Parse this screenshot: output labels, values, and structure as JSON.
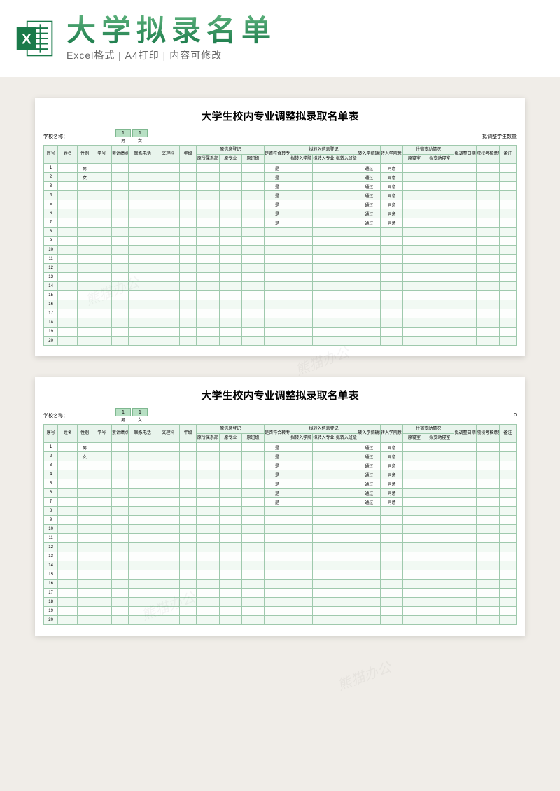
{
  "header": {
    "title": "大学拟录名单",
    "subtitle": "Excel格式 | A4打印 | 内容可修改"
  },
  "sheet": {
    "title": "大学生校内专业调整拟录取名单表",
    "school_label": "学校名称：",
    "count_label_right_1": "拟调整学生数量",
    "count_label_right_2": "0",
    "counter_male_val": "1",
    "counter_female_val": "1",
    "counter_male_label": "男",
    "counter_female_label": "女",
    "headers": {
      "seq": "序号",
      "name": "姓名",
      "gender": "性别",
      "sid": "学号",
      "gpa": "累计绩点",
      "phone": "联系电话",
      "sci": "文理科",
      "grade": "年级",
      "orig_group": "原信息登记",
      "orig_dept": "原所属系部",
      "orig_major": "原专业",
      "orig_class": "原班级",
      "cond": "是否符合转专业条件",
      "trans_group": "拟转入信息登记",
      "trans_college": "拟转入学院",
      "trans_major": "拟转入专业",
      "trans_class": "拟转入班级",
      "confirm": "转入学院确认",
      "opinion": "转入学院意见",
      "dorm_group": "住宿变动情况",
      "dorm_orig": "原寝室",
      "dorm_new": "拟变动寝室",
      "adj_date": "拟调整日期",
      "check": "院校考核意见",
      "note": "备注"
    },
    "rows": [
      {
        "seq": "1",
        "gender": "男",
        "cond": "是",
        "confirm": "通过",
        "opinion": "同意"
      },
      {
        "seq": "2",
        "gender": "女",
        "cond": "是",
        "confirm": "通过",
        "opinion": "同意"
      },
      {
        "seq": "3",
        "gender": "",
        "cond": "是",
        "confirm": "通过",
        "opinion": "同意"
      },
      {
        "seq": "4",
        "gender": "",
        "cond": "是",
        "confirm": "通过",
        "opinion": "同意"
      },
      {
        "seq": "5",
        "gender": "",
        "cond": "是",
        "confirm": "通过",
        "opinion": "同意"
      },
      {
        "seq": "6",
        "gender": "",
        "cond": "是",
        "confirm": "通过",
        "opinion": "同意"
      },
      {
        "seq": "7",
        "gender": "",
        "cond": "是",
        "confirm": "通过",
        "opinion": "同意"
      },
      {
        "seq": "8",
        "gender": "",
        "cond": "",
        "confirm": "",
        "opinion": ""
      },
      {
        "seq": "9",
        "gender": "",
        "cond": "",
        "confirm": "",
        "opinion": ""
      },
      {
        "seq": "10",
        "gender": "",
        "cond": "",
        "confirm": "",
        "opinion": ""
      },
      {
        "seq": "11",
        "gender": "",
        "cond": "",
        "confirm": "",
        "opinion": ""
      },
      {
        "seq": "12",
        "gender": "",
        "cond": "",
        "confirm": "",
        "opinion": ""
      },
      {
        "seq": "13",
        "gender": "",
        "cond": "",
        "confirm": "",
        "opinion": ""
      },
      {
        "seq": "14",
        "gender": "",
        "cond": "",
        "confirm": "",
        "opinion": ""
      },
      {
        "seq": "15",
        "gender": "",
        "cond": "",
        "confirm": "",
        "opinion": ""
      },
      {
        "seq": "16",
        "gender": "",
        "cond": "",
        "confirm": "",
        "opinion": ""
      },
      {
        "seq": "17",
        "gender": "",
        "cond": "",
        "confirm": "",
        "opinion": ""
      },
      {
        "seq": "18",
        "gender": "",
        "cond": "",
        "confirm": "",
        "opinion": ""
      },
      {
        "seq": "19",
        "gender": "",
        "cond": "",
        "confirm": "",
        "opinion": ""
      },
      {
        "seq": "20",
        "gender": "",
        "cond": "",
        "confirm": "",
        "opinion": ""
      }
    ]
  }
}
